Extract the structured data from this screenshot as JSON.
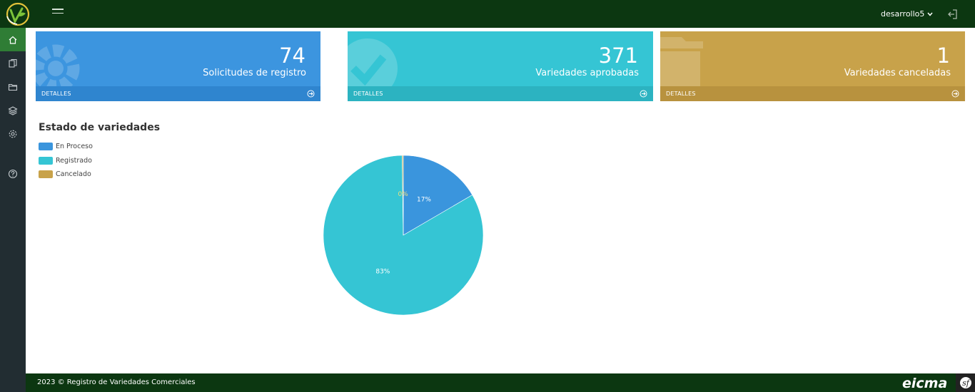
{
  "header": {
    "user": "desarrollo5"
  },
  "cards": [
    {
      "value": "74",
      "label": "Solicitudes de registro",
      "footer": "DETALLES",
      "color": "#3c95df",
      "icon": "gear-icon"
    },
    {
      "value": "371",
      "label": "Variedades aprobadas",
      "footer": "DETALLES",
      "color": "#35c5d4",
      "icon": "check-circle-icon"
    },
    {
      "value": "1",
      "label": "Variedades canceladas",
      "footer": "DETALLES",
      "color": "#c8a24a",
      "icon": "folder-icon"
    }
  ],
  "sidebar": {
    "items": [
      {
        "icon": "home-icon",
        "active": true
      },
      {
        "icon": "copy-icon"
      },
      {
        "icon": "folder-icon"
      },
      {
        "icon": "layers-icon"
      },
      {
        "icon": "gear-icon"
      },
      {
        "icon": "help-icon"
      }
    ]
  },
  "chart_data": {
    "type": "pie",
    "title": "Estado de variedades",
    "categories": [
      "En Proceso",
      "Registrado",
      "Cancelado"
    ],
    "values": [
      74,
      371,
      1
    ],
    "percent_labels": [
      "17%",
      "83%",
      "0%"
    ],
    "colors": [
      "#3a95dd",
      "#35c5d4",
      "#c8a24a"
    ],
    "legend": "top-left"
  },
  "footer": {
    "text": "2023 © Registro de Variedades Comerciales",
    "brand": "eicma"
  }
}
